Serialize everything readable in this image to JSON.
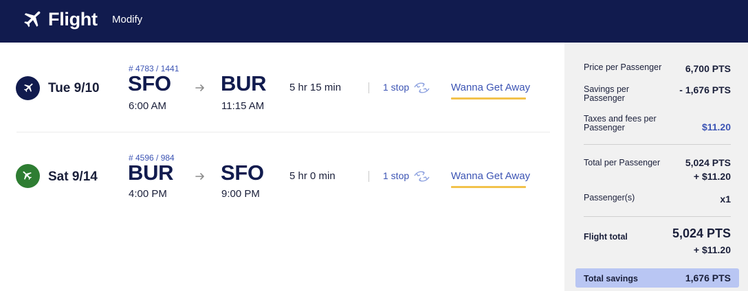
{
  "header": {
    "icon": "plane-icon",
    "title": "Flight",
    "modify_label": "Modify",
    "background": "#111b4e"
  },
  "legs": [
    {
      "direction_icon": "departing-plane-icon",
      "circle_color": "#111b4e",
      "date": "Tue 9/10",
      "flight_numbers": "# 4783 / 1441",
      "from_code": "SFO",
      "from_time": "6:00 AM",
      "to_code": "BUR",
      "to_time": "11:15 AM",
      "duration": "5 hr 15 min",
      "stops": "1 stop",
      "fare": "Wanna Get Away"
    },
    {
      "direction_icon": "returning-plane-icon",
      "circle_color": "#2e7d32",
      "date": "Sat 9/14",
      "flight_numbers": "# 4596 / 984",
      "from_code": "BUR",
      "from_time": "4:00 PM",
      "to_code": "SFO",
      "to_time": "9:00 PM",
      "duration": "5 hr 0 min",
      "stops": "1 stop",
      "fare": "Wanna Get Away"
    }
  ],
  "summary": {
    "price_per_passenger_label": "Price per Passenger",
    "price_per_passenger_value": "6,700 PTS",
    "savings_per_passenger_label": "Savings per Passenger",
    "savings_per_passenger_value": "- 1,676 PTS",
    "taxes_label": "Taxes and fees per Passenger",
    "taxes_value": "$11.20",
    "total_per_passenger_label": "Total per Passenger",
    "total_per_passenger_pts": "5,024 PTS",
    "total_per_passenger_fee": "+ $11.20",
    "passengers_label": "Passenger(s)",
    "passengers_value": "x1",
    "flight_total_label": "Flight total",
    "flight_total_pts": "5,024 PTS",
    "flight_total_fee": "+ $11.20",
    "total_savings_label": "Total savings",
    "total_savings_value": "1,676 PTS",
    "accent_blue": "#3c54b4",
    "savings_highlight": "#b9c6f3",
    "fare_underline": "#f2c24b"
  }
}
